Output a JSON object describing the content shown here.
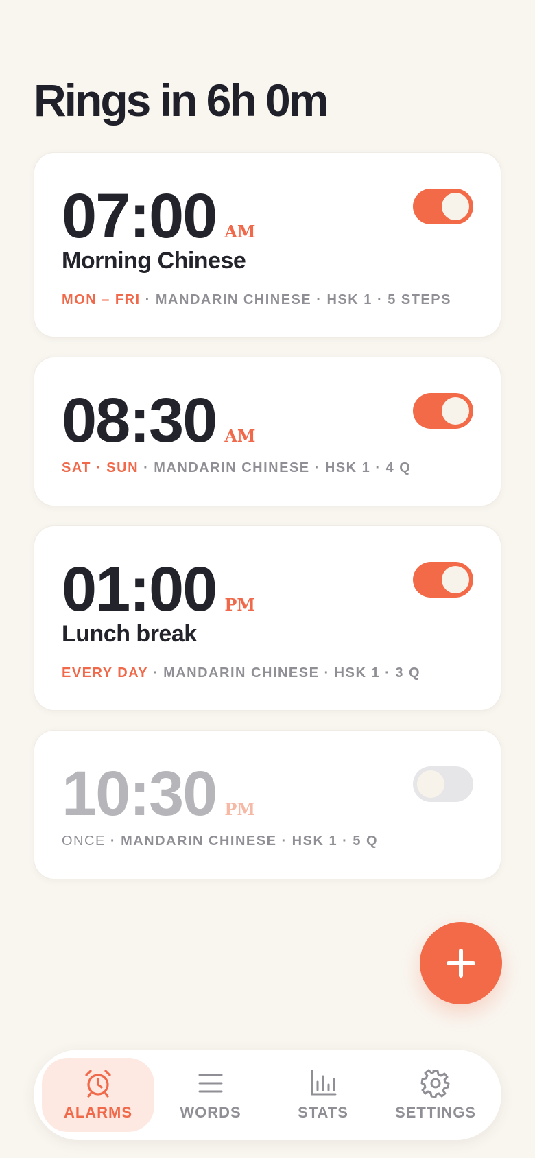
{
  "header": {
    "title": "Rings in 6h 0m"
  },
  "alarms": [
    {
      "time": "07:00",
      "ampm": "AM",
      "label": "Morning Chinese",
      "days": "MON – FRI",
      "details": " · MANDARIN CHINESE · HSK 1 · 5 STEPS",
      "enabled": true
    },
    {
      "time": "08:30",
      "ampm": "AM",
      "label": "",
      "days": "SAT · SUN",
      "details": " · MANDARIN CHINESE · HSK 1 · 4 Q",
      "enabled": true
    },
    {
      "time": "01:00",
      "ampm": "PM",
      "label": "Lunch break",
      "days": "EVERY DAY",
      "details": " · MANDARIN CHINESE · HSK 1 · 3 Q",
      "enabled": true
    },
    {
      "time": "10:30",
      "ampm": "PM",
      "label": "",
      "days": "ONCE",
      "details": " · MANDARIN CHINESE · HSK 1 · 5 Q",
      "enabled": false
    }
  ],
  "fab": {
    "icon": "plus-icon"
  },
  "nav": {
    "items": [
      {
        "label": "ALARMS",
        "icon": "alarm-clock-icon",
        "active": true
      },
      {
        "label": "WORDS",
        "icon": "list-icon",
        "active": false
      },
      {
        "label": "STATS",
        "icon": "bar-chart-icon",
        "active": false
      },
      {
        "label": "SETTINGS",
        "icon": "gear-icon",
        "active": false
      }
    ]
  },
  "colors": {
    "accent": "#f26a48",
    "background": "#f9f6f0",
    "text": "#23232b",
    "muted": "#8f8f95"
  }
}
